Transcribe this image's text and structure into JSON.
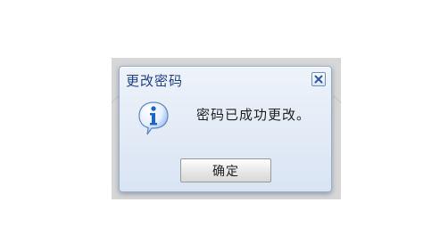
{
  "dialog": {
    "title": "更改密码",
    "message": "密码已成功更改。",
    "ok_label": "确定",
    "close_icon": "close-icon",
    "info_icon": "info-icon",
    "colors": {
      "title": "#1f3f86",
      "dialog_bg": "#dbe5f4",
      "icon": "#1e63c9"
    }
  }
}
